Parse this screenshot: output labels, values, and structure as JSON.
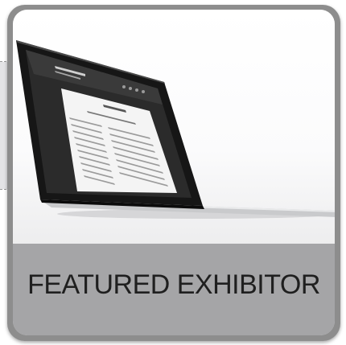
{
  "card": {
    "caption": "FEATURED EXHIBITOR"
  },
  "colors": {
    "card_border": "#8d8d8d",
    "caption_bg": "#a5a5a7",
    "caption_text": "#1f1f1f",
    "laptop_bezel": "#1a1a1a"
  },
  "image": {
    "subject": "laptop-with-webpage-icon"
  }
}
